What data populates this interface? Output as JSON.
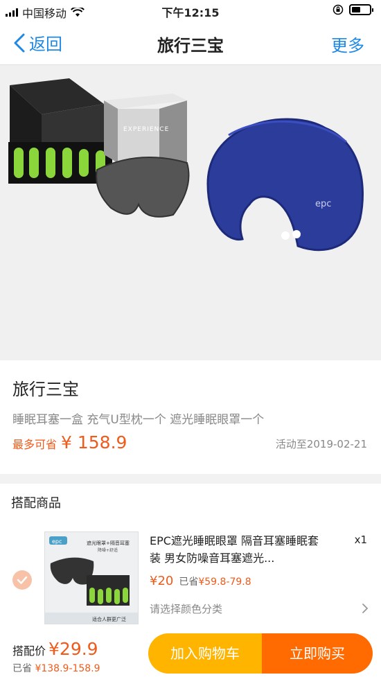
{
  "status_bar": {
    "carrier": "中国移动",
    "time": "下午12:15"
  },
  "nav": {
    "back_label": "返回",
    "title": "旅行三宝",
    "more_label": "更多"
  },
  "product": {
    "title": "旅行三宝",
    "description": "睡眠耳塞一盒 充气U型枕一个 遮光睡眠眼罩一个",
    "save_label": "最多可省",
    "save_amount": "¥ 158.9",
    "activity_until": "活动至2019-02-21",
    "hero_box_text": "EXPERIENCE",
    "pillow_logo": "epc"
  },
  "combo": {
    "header": "搭配商品",
    "item": {
      "name": "EPC遮光睡眠眼罩 隔音耳塞睡眠套装 男女防噪音耳塞遮光...",
      "quantity": "x1",
      "price": "¥20",
      "saved_label": "已省",
      "saved_range": "¥59.8-79.8",
      "select_prompt": "请选择颜色分类",
      "thumb_brand": "epc",
      "thumb_headline": "遮光眼罩+隔音耳塞",
      "thumb_sub": "降噪+舒适",
      "thumb_footer": "适合人群更广泛"
    },
    "combo_price_label": "搭配价",
    "combo_price": "¥29.9",
    "combo_saved_label": "已省",
    "combo_saved": "¥138.9-158.9"
  },
  "actions": {
    "add_cart": "加入购物车",
    "buy_now": "立即购买"
  },
  "colors": {
    "accent_blue": "#1e88e5",
    "price_orange": "#f05a1a",
    "cart_yellow": "#ffb400",
    "buy_orange": "#ff6b00"
  }
}
